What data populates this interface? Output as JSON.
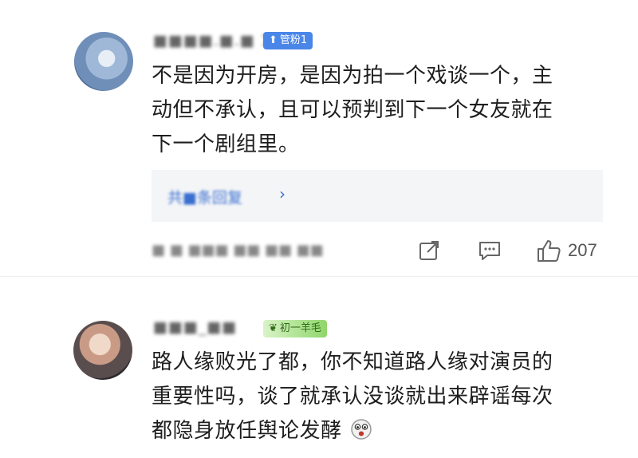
{
  "comments": [
    {
      "username": "■■■■.■.■ 1",
      "badge": "管粉1",
      "badge_icon": "up-arrow-icon",
      "lines": [
        "不是因为开房，是因为拍一个戏谈一个，主",
        "动但不承认，且可以预判到下一个女友就在",
        "下一个剧组里。"
      ],
      "reply_link": "共■条回复",
      "meta": "■ ■ ■■■ ■■ ■■ ■■",
      "like_count": "207"
    },
    {
      "username": "■■■_■■",
      "badge": "初一羊毛",
      "badge_icon": "wheat-icon",
      "lines": [
        "路人缘败光了都，你不知道路人缘对演员的",
        "重要性吗，谈了就承认没谈就出来辟谣每次",
        "都隐身放任舆论发酵"
      ],
      "end_emoji": "surprised-face-icon"
    }
  ],
  "colors": {
    "accent_blue": "#4a86e8",
    "link_blue": "#3a6fd0",
    "muted_text": "#888888"
  }
}
